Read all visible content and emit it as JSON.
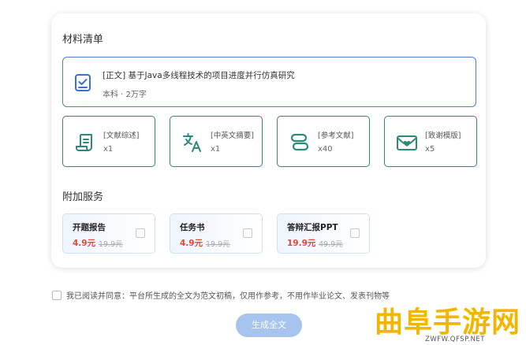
{
  "colors": {
    "accent_blue": "#4a7fd9",
    "teal": "#2d8a78",
    "price_red": "#e0473b",
    "button_blue": "#a7c4ef",
    "watermark_yellow": "#f3b600"
  },
  "materials": {
    "title": "材料清单",
    "main_item": {
      "icon": "document-check-icon",
      "title": "[正文] 基于Java多线程技术的项目进度并行仿真研究",
      "subtitle": "本科 · 2万字"
    },
    "items": [
      {
        "icon": "scroll-icon",
        "label": "[文献综述]",
        "count": "x1"
      },
      {
        "icon": "translate-icon",
        "label": "[中英文摘要]",
        "count": "x1"
      },
      {
        "icon": "reference-icon",
        "label": "[参考文献]",
        "count": "x40"
      },
      {
        "icon": "heart-envelope-icon",
        "label": "[致谢模版]",
        "count": "x5"
      }
    ]
  },
  "services": {
    "title": "附加服务",
    "items": [
      {
        "name": "开题报告",
        "price": "4.9元",
        "original": "19.9元",
        "checked": false
      },
      {
        "name": "任务书",
        "price": "4.9元",
        "original": "19.9元",
        "checked": false
      },
      {
        "name": "答辩汇报PPT",
        "price": "19.9元",
        "original": "49.9元",
        "checked": false
      }
    ]
  },
  "agreement": {
    "text": "我已阅读并同意：平台所生成的全文为范文初稿，仅用作参考，不用作毕业论文、发表刊物等",
    "checked": false
  },
  "generate_button": {
    "label": "生成全文"
  },
  "watermark": {
    "text": "曲阜手游网",
    "url": "ZWFW.QFSP.NET"
  }
}
